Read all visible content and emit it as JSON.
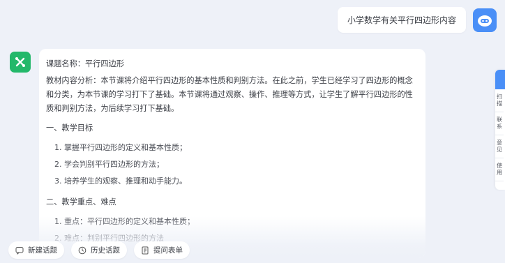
{
  "user_message": "小学数学有关平行四边形内容",
  "answer": {
    "title": "课题名称：平行四边形",
    "analysis": "教材内容分析：本节课将介绍平行四边形的基本性质和判别方法。在此之前，学生已经学习了四边形的概念和分类，为本节课的学习打下了基础。本节课将通过观察、操作、推理等方式，让学生了解平行四边形的性质和判别方法，为后续学习打下基础。",
    "section1_heading": "一、教学目标",
    "goals": [
      "1. 掌握平行四边形的定义和基本性质；",
      "2. 学会判别平行四边形的方法；",
      "3. 培养学生的观察、推理和动手能力。"
    ],
    "section2_heading": "二、教学重点、难点",
    "key_points": [
      "1. 重点：平行四边形的定义和基本性质；",
      "2. 难点：判别平行四边形的方法"
    ]
  },
  "bottom_bar": {
    "new_topic": "新建话题",
    "history": "历史话题",
    "form": "提问表单"
  },
  "side_panel": {
    "items": [
      "扫",
      "联",
      "意",
      "使"
    ],
    "items_second": [
      "描",
      "系",
      "见",
      "用"
    ]
  },
  "colors": {
    "background": "#eef1f8",
    "bot_avatar": "#4a8ff7",
    "ai_avatar": "#23b86a"
  }
}
